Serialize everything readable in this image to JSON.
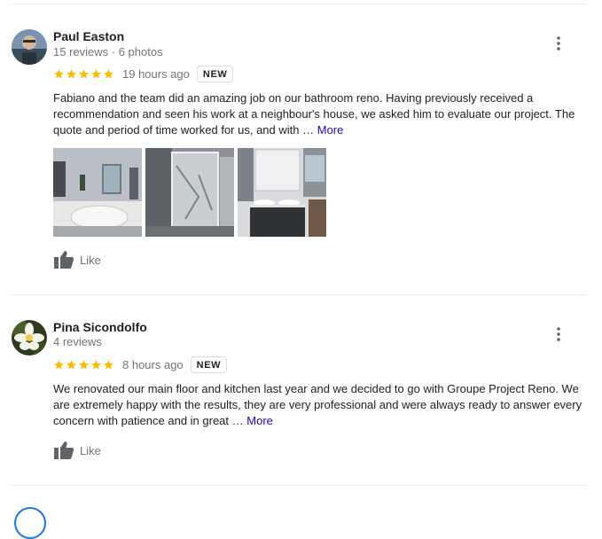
{
  "reviews": [
    {
      "name": "Paul Easton",
      "meta": "15 reviews · 6 photos",
      "rating": 5,
      "time": "19 hours ago",
      "badge": "NEW",
      "text": "Fabiano and the team did an amazing job on our bathroom reno. Having previously received a recommendation and seen his work at a neighbour's house, we asked him to evaluate our project. The quote and period of time worked for us, and with …",
      "more_label": "More",
      "like_label": "Like",
      "photo_count_shown": 3
    },
    {
      "name": "Pina Sicondolfo",
      "meta": "4 reviews",
      "rating": 5,
      "time": "8 hours ago",
      "badge": "NEW",
      "text": "We renovated our main floor and kitchen last year and we decided to go with Groupe Project Reno. We are extremely happy with the results, they are very professional and were always ready to answer every concern with patience and in great …",
      "more_label": "More",
      "like_label": "Like"
    }
  ],
  "colors": {
    "star": "#fbbc04",
    "link": "#1a0dab",
    "muted": "#70757a",
    "divider": "#e8eaed"
  },
  "icons": {
    "menu": "more-vert-icon",
    "like": "thumb-up-icon",
    "star": "star-icon"
  }
}
